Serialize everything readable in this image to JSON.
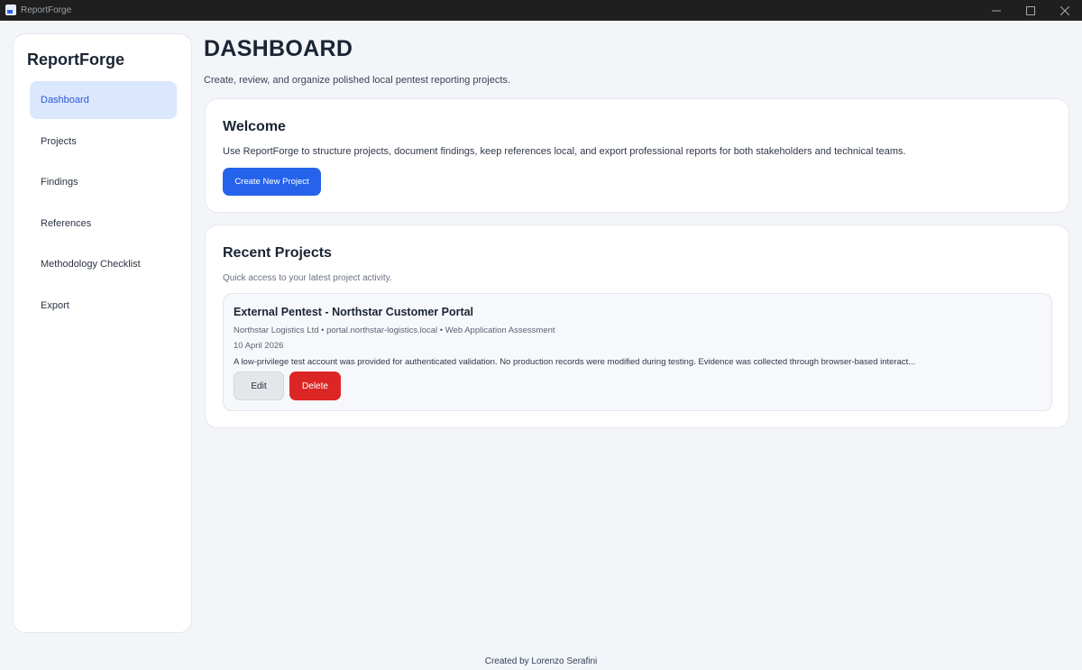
{
  "window": {
    "title": "ReportForge"
  },
  "sidebar": {
    "brand": "ReportForge",
    "items": [
      {
        "label": "Dashboard",
        "active": true
      },
      {
        "label": "Projects"
      },
      {
        "label": "Findings"
      },
      {
        "label": "References"
      },
      {
        "label": "Methodology Checklist"
      },
      {
        "label": "Export"
      }
    ]
  },
  "main": {
    "title": "DASHBOARD",
    "subtitle": "Create, review, and organize polished local pentest reporting projects.",
    "welcome": {
      "heading": "Welcome",
      "text": "Use ReportForge to structure projects, document findings, keep references local, and export professional reports for both stakeholders and technical teams.",
      "button": "Create New Project"
    },
    "recent": {
      "heading": "Recent Projects",
      "subtitle": "Quick access to your latest project activity.",
      "projects": [
        {
          "title": "External Pentest - Northstar Customer Portal",
          "meta": "Northstar Logistics Ltd • portal.northstar-logistics.local • Web Application Assessment",
          "date": "10 April 2026",
          "description": "A low-privilege test account was provided for authenticated validation. No production records were modified during testing. Evidence was collected through browser-based interact...",
          "edit_label": "Edit",
          "delete_label": "Delete"
        }
      ]
    }
  },
  "footer": {
    "text": "Created by Lorenzo Serafini"
  },
  "colors": {
    "accent": "#2563eb",
    "danger": "#dc2626",
    "active_nav_bg": "#dbe7fd"
  }
}
